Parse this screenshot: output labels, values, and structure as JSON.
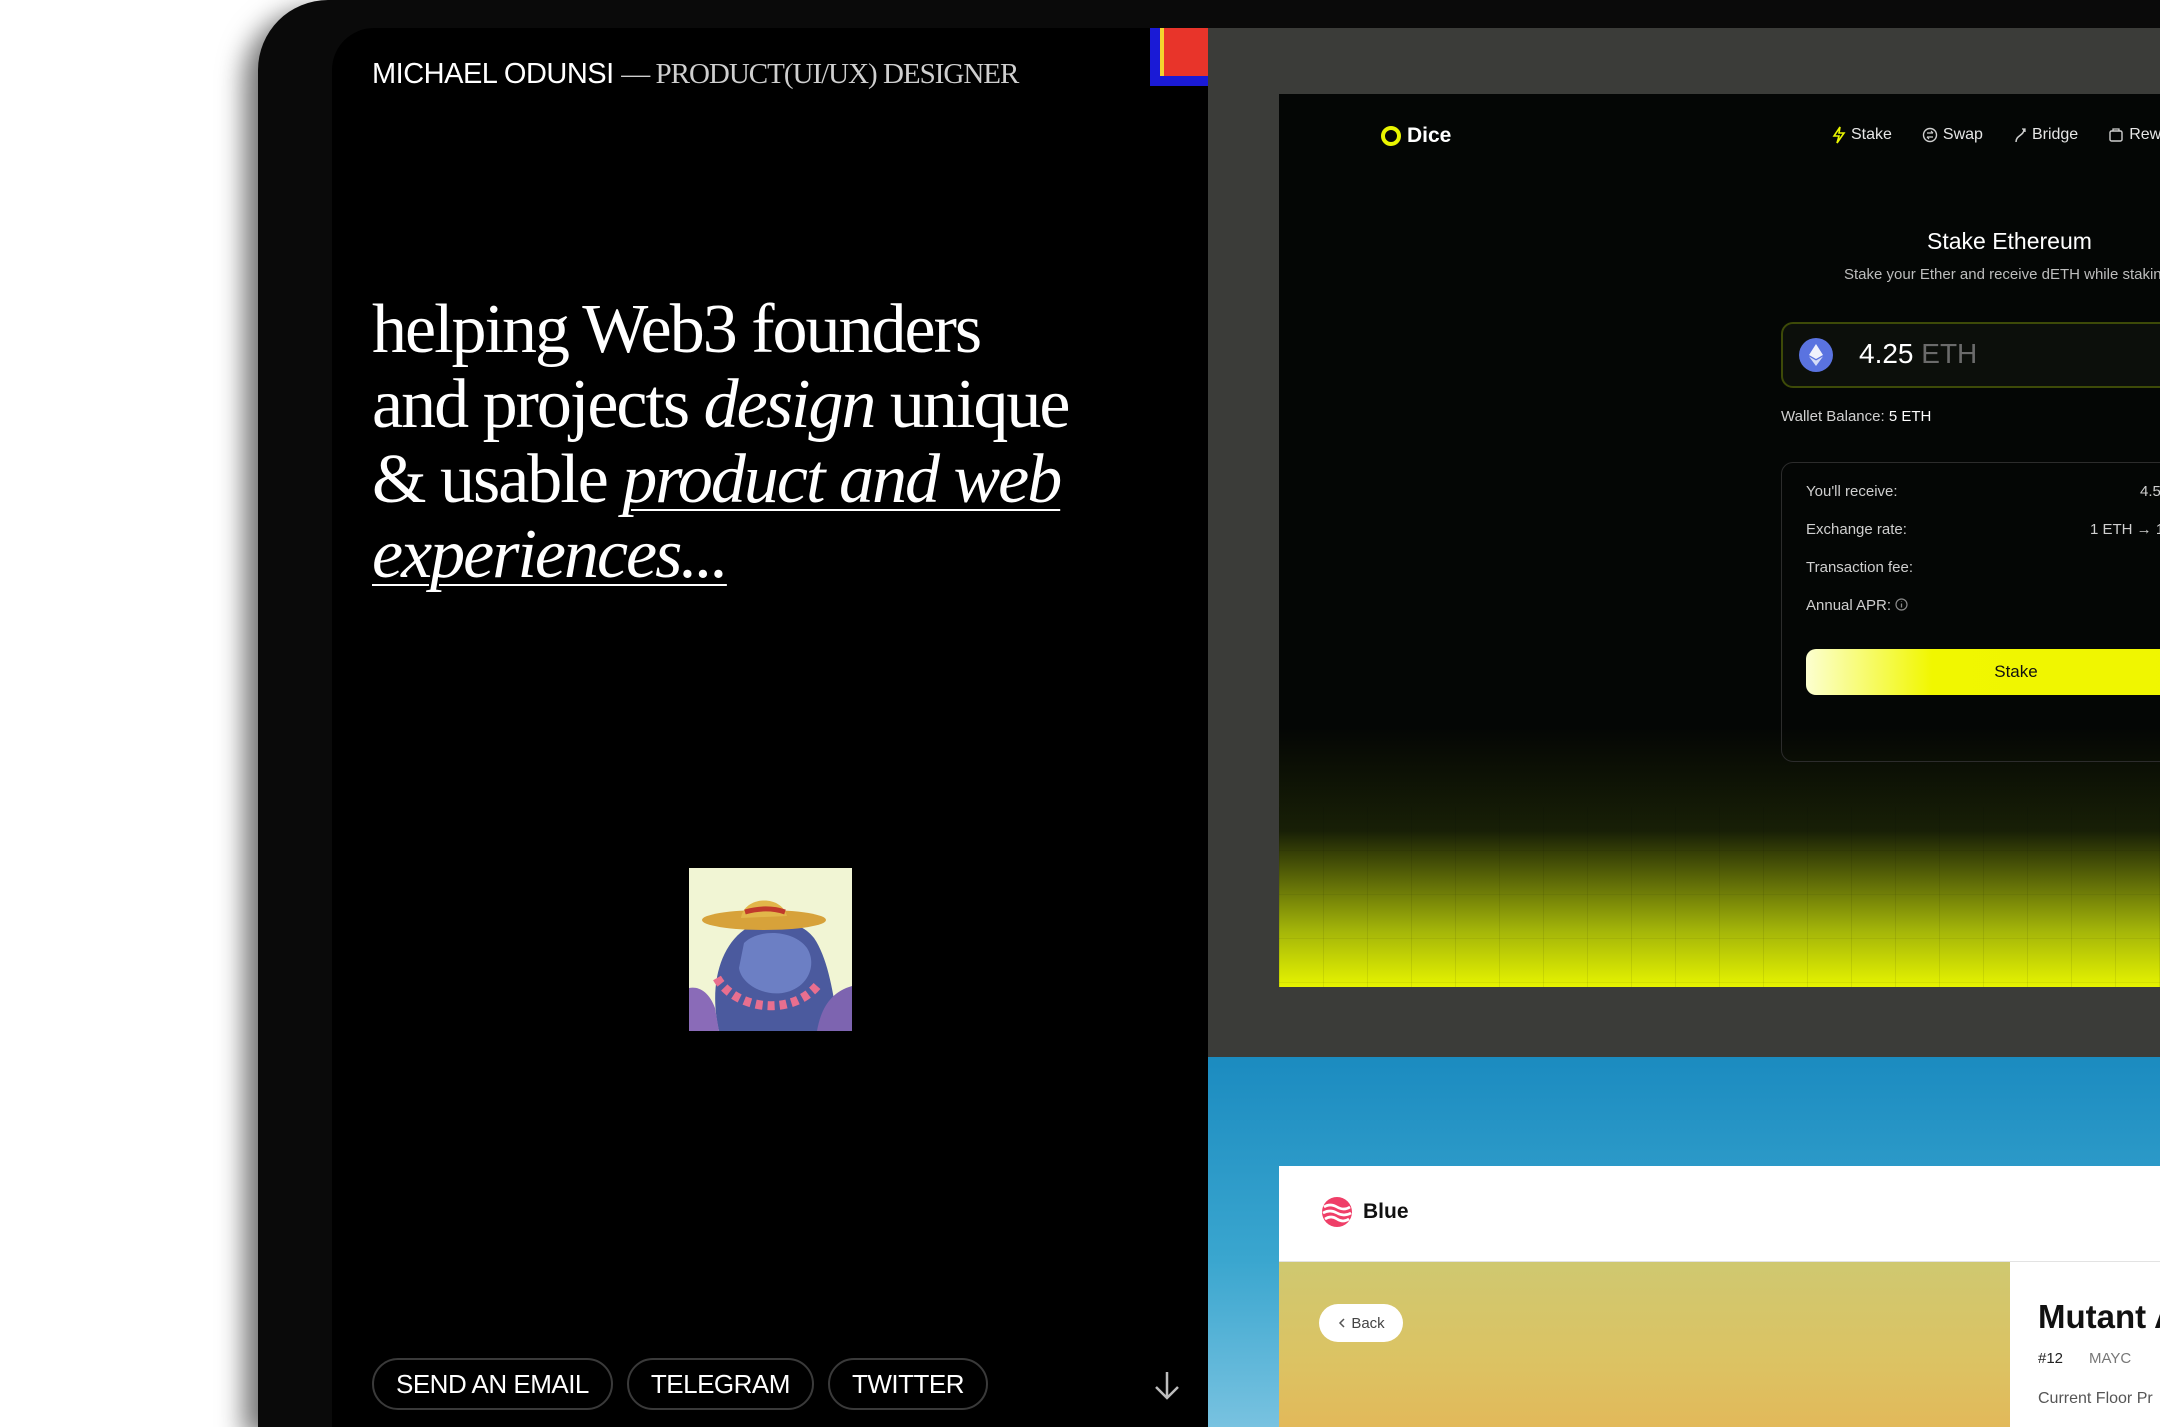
{
  "header": {
    "name": "MICHAEL ODUNSI",
    "role": "— PRODUCT(UI/UX) DESIGNER"
  },
  "tagline": {
    "part1": "helping Web3 founders and projects ",
    "em1": "design",
    "part2": " unique & usable ",
    "em2": "product and web experiences..."
  },
  "socials": [
    {
      "label": "SEND AN EMAIL"
    },
    {
      "label": "TELEGRAM"
    },
    {
      "label": "TWITTER"
    }
  ],
  "icons": {
    "scroll": "arrow-down-icon",
    "eth": "ethereum-icon",
    "info": "info-icon",
    "back": "chevron-left-icon"
  },
  "colors": {
    "accent_yellow": "#eff500",
    "eth_blue": "#5a73e0",
    "blue_brand": "#ef3f68"
  },
  "dice": {
    "logo": "Dice",
    "nav": [
      {
        "label": "Stake",
        "icon": "bolt-icon"
      },
      {
        "label": "Swap",
        "icon": "swap-icon"
      },
      {
        "label": "Bridge",
        "icon": "bridge-icon"
      },
      {
        "label": "Rew",
        "icon": "rewards-icon"
      }
    ],
    "title": "Stake Ethereum",
    "subtitle": "Stake your Ether and receive dETH while stakin",
    "amount": "4.25",
    "unit": "ETH",
    "wallet_label": "Wallet Balance:",
    "wallet_value": "5 ETH",
    "rows": {
      "receive_label": "You'll receive:",
      "receive_value": "4.5",
      "rate_label": "Exchange rate:",
      "rate_value": "1 ETH → 1",
      "fee_label": "Transaction fee:",
      "apr_label": "Annual APR:"
    },
    "stake_button": "Stake"
  },
  "blue": {
    "logo": "Blue",
    "back": "Back",
    "title": "Mutant A",
    "token": "#12",
    "collection": "MAYC",
    "floor": "Current Floor Pr"
  }
}
